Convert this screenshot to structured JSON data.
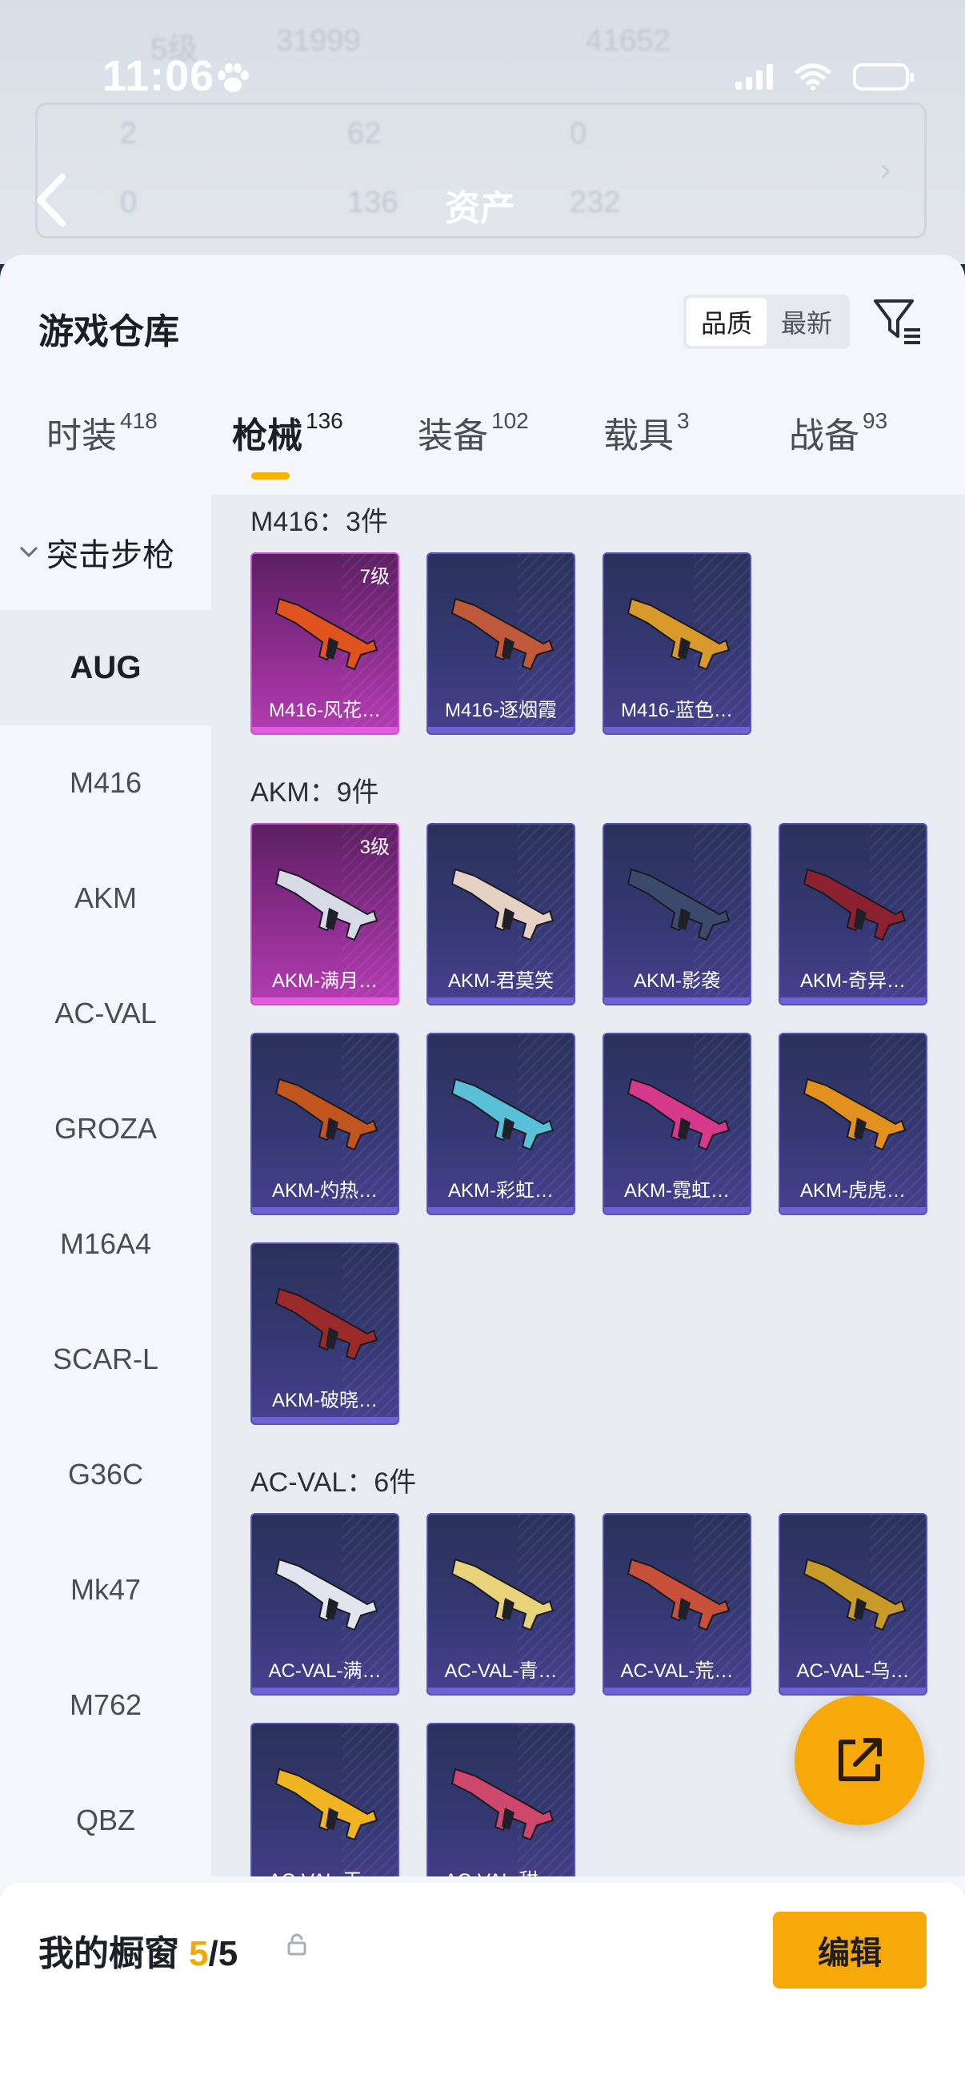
{
  "status_bar": {
    "time": "11:06"
  },
  "background": {
    "title": "资产",
    "ghost_values": [
      "5级",
      "31999",
      "41652",
      "2",
      "62",
      "0",
      "0",
      "136",
      "232"
    ]
  },
  "sheet": {
    "title": "游戏仓库",
    "sort_options": [
      {
        "label": "品质",
        "active": true
      },
      {
        "label": "最新",
        "active": false
      }
    ]
  },
  "tabs": [
    {
      "label": "时装",
      "count": "418",
      "active": false
    },
    {
      "label": "枪械",
      "count": "136",
      "active": true
    },
    {
      "label": "装备",
      "count": "102",
      "active": false
    },
    {
      "label": "载具",
      "count": "3",
      "active": false
    },
    {
      "label": "战备",
      "count": "93",
      "active": false
    }
  ],
  "rail": {
    "group": "突击步枪",
    "items": [
      "AUG",
      "M416",
      "AKM",
      "AC-VAL",
      "GROZA",
      "M16A4",
      "SCAR-L",
      "G36C",
      "Mk47",
      "M762",
      "QBZ"
    ],
    "active_index": 0
  },
  "sections": [
    {
      "title": "M416：3件",
      "items": [
        {
          "name": "M416-风花…",
          "level": "7级",
          "rarity": "epic",
          "color": "#e0521e"
        },
        {
          "name": "M416-逐烟霞",
          "level": "",
          "rarity": "rare",
          "color": "#c0583a"
        },
        {
          "name": "M416-蓝色…",
          "level": "",
          "rarity": "rare",
          "color": "#d89a2a"
        }
      ]
    },
    {
      "title": "AKM：9件",
      "items": [
        {
          "name": "AKM-满月…",
          "level": "3级",
          "rarity": "epic",
          "color": "#d8dbe6"
        },
        {
          "name": "AKM-君莫笑",
          "level": "",
          "rarity": "rare",
          "color": "#e6d2c4"
        },
        {
          "name": "AKM-影袭",
          "level": "",
          "rarity": "rare",
          "color": "#3b4a6a"
        },
        {
          "name": "AKM-奇异…",
          "level": "",
          "rarity": "rare",
          "color": "#8a2030"
        },
        {
          "name": "AKM-灼热…",
          "level": "",
          "rarity": "rare",
          "color": "#c0561e"
        },
        {
          "name": "AKM-彩虹…",
          "level": "",
          "rarity": "rare",
          "color": "#5ac0d8"
        },
        {
          "name": "AKM-霓虹…",
          "level": "",
          "rarity": "rare",
          "color": "#d8388a"
        },
        {
          "name": "AKM-虎虎…",
          "level": "",
          "rarity": "rare",
          "color": "#e2901e"
        },
        {
          "name": "AKM-破晓…",
          "level": "",
          "rarity": "rare",
          "color": "#9a2a2a"
        }
      ]
    },
    {
      "title": "AC-VAL：6件",
      "items": [
        {
          "name": "AC-VAL-满…",
          "level": "",
          "rarity": "rare",
          "color": "#e4e4ee"
        },
        {
          "name": "AC-VAL-青…",
          "level": "",
          "rarity": "rare",
          "color": "#e8d27a"
        },
        {
          "name": "AC-VAL-荒…",
          "level": "",
          "rarity": "rare",
          "color": "#c8503a"
        },
        {
          "name": "AC-VAL-乌…",
          "level": "",
          "rarity": "rare",
          "color": "#c89a28"
        },
        {
          "name": "AC-VAL-天…",
          "level": "",
          "rarity": "rare",
          "color": "#f0b422"
        },
        {
          "name": "AC-VAL-甜…",
          "level": "",
          "rarity": "rare",
          "color": "#d0476e"
        }
      ]
    }
  ],
  "bottom": {
    "label": "我的橱窗",
    "count": "5",
    "separator": "/",
    "total": "5",
    "edit_label": "编辑"
  },
  "colors": {
    "accent": "#f7a90c",
    "epic": "#b43cb2",
    "rare": "#47408f"
  }
}
